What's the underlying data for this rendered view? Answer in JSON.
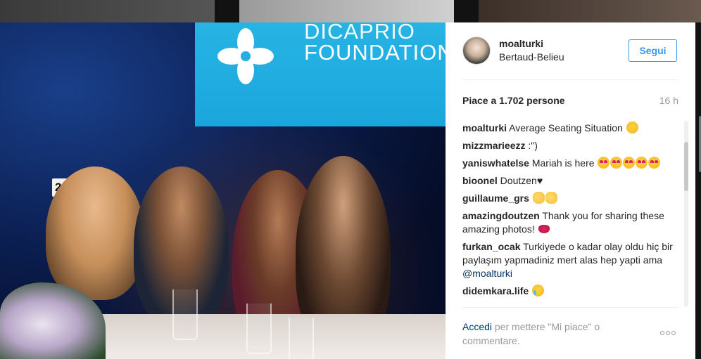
{
  "post": {
    "screen_text_line1": "DICAPRIO",
    "screen_text_line2": "FOUNDATION",
    "table_number": "24"
  },
  "header": {
    "username": "moalturki",
    "location": "Bertaud-Belieu",
    "follow_label": "Segui"
  },
  "meta": {
    "likes": "Piace a 1.702 persone",
    "time": "16 h"
  },
  "comments": [
    {
      "user": "moalturki",
      "text": "Average Seating Situation",
      "emoji": "smirk-emoji"
    },
    {
      "user": "mizzmarieezz",
      "text": ":\")"
    },
    {
      "user": "yanisw hatelse",
      "text": "Mariah is here",
      "emoji": "heart-eyes-emoji x5"
    },
    {
      "user": "bioonel",
      "text": "Doutzen♥"
    },
    {
      "user": "guillaume_grs",
      "text": "",
      "emoji": "clapping-hands-emoji x2"
    },
    {
      "user": "amazingdoutzen",
      "text": "Thank you for sharing these amazing photos!",
      "emoji": "kiss-mark-emoji"
    },
    {
      "user": "furkan_ocak",
      "text": "Turkiyede o kadar olay oldu hiç bir paylaşım yapmadiniz mert alas hep yapti ama",
      "mention": "@moalturki"
    },
    {
      "user": "didemkara.life",
      "text": "",
      "emoji": "tears-of-joy-emoji"
    }
  ],
  "footer": {
    "login_label": "Accedi",
    "text": "per mettere \"Mi piace\" o commentare."
  },
  "icons": {
    "more": "more-options-icon"
  }
}
